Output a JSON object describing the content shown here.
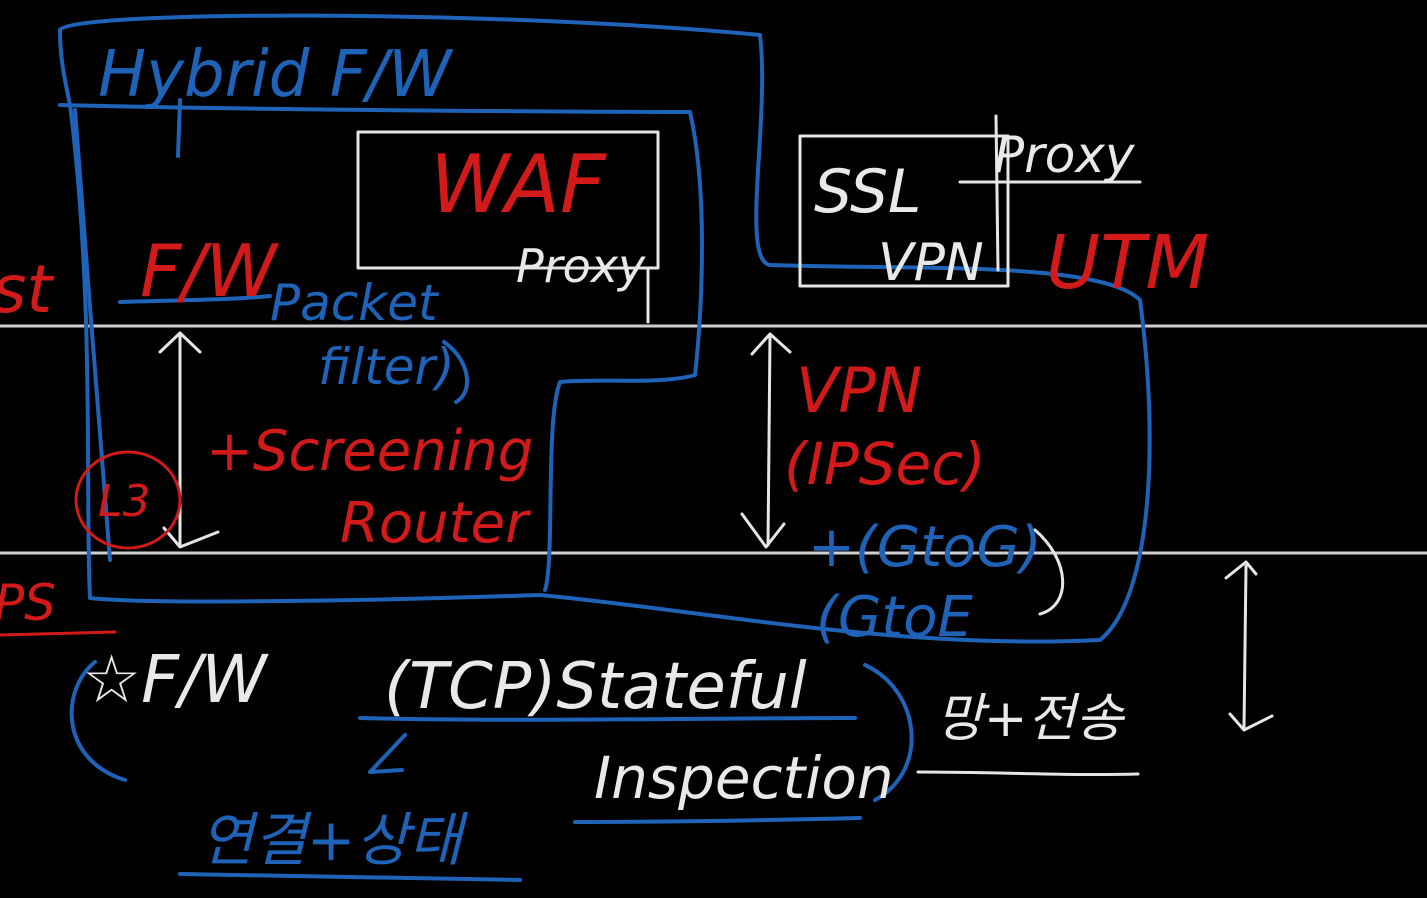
{
  "colors": {
    "background": "#000000",
    "red_ink": "#d21a1a",
    "white_ink": "#e9e9e9",
    "blue_ink": "#1f63b8",
    "rule_line": "#cfcfcf"
  },
  "labels": {
    "hybrid_fw": "Hybrid F/W",
    "waf": "WAF",
    "waf_proxy": "Proxy",
    "fw": "F/W",
    "packet": "Packet",
    "filter": "filter)",
    "screening": "+Screening",
    "router": "Router",
    "l3": "L3",
    "ssl": "SSL",
    "ssl_vpn": "VPN",
    "proxy_right": "Proxy",
    "utm": "UTM",
    "vpn": "VPN",
    "ipsec": "(IPSec)",
    "gtog": "+(GtoG)",
    "gtoe": "(GtoE",
    "star_fw": "☆F/W",
    "tcp_stateful": "(TCP)Stateful",
    "inspection": "Inspection",
    "yeongyeol_sangtae": "연결+상태",
    "mang_jeonsong": "망+전송",
    "edge_st": "st",
    "edge_ps": "PS"
  }
}
